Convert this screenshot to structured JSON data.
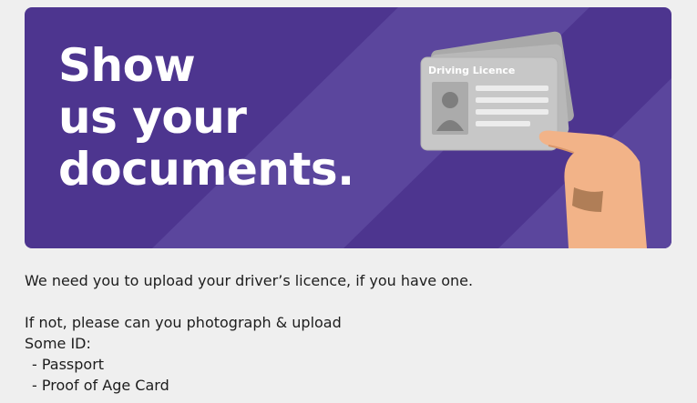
{
  "banner": {
    "headline_lines": [
      "Show",
      "us your",
      "documents."
    ],
    "card_label": "Driving Licence",
    "colors": {
      "background": "#4d358f",
      "stripe": "#5b469d",
      "card": "#c7c7c7",
      "hand": "#f2b388"
    },
    "illustration_icon": "id-card-in-hand-icon"
  },
  "message": {
    "intro": "We need you to upload your driver’s licence, if you have one.",
    "alt_line_1": "If not, please can you photograph & upload",
    "alt_line_2": "Some ID:",
    "options": [
      "- Passport",
      "- Proof of Age Card"
    ]
  }
}
